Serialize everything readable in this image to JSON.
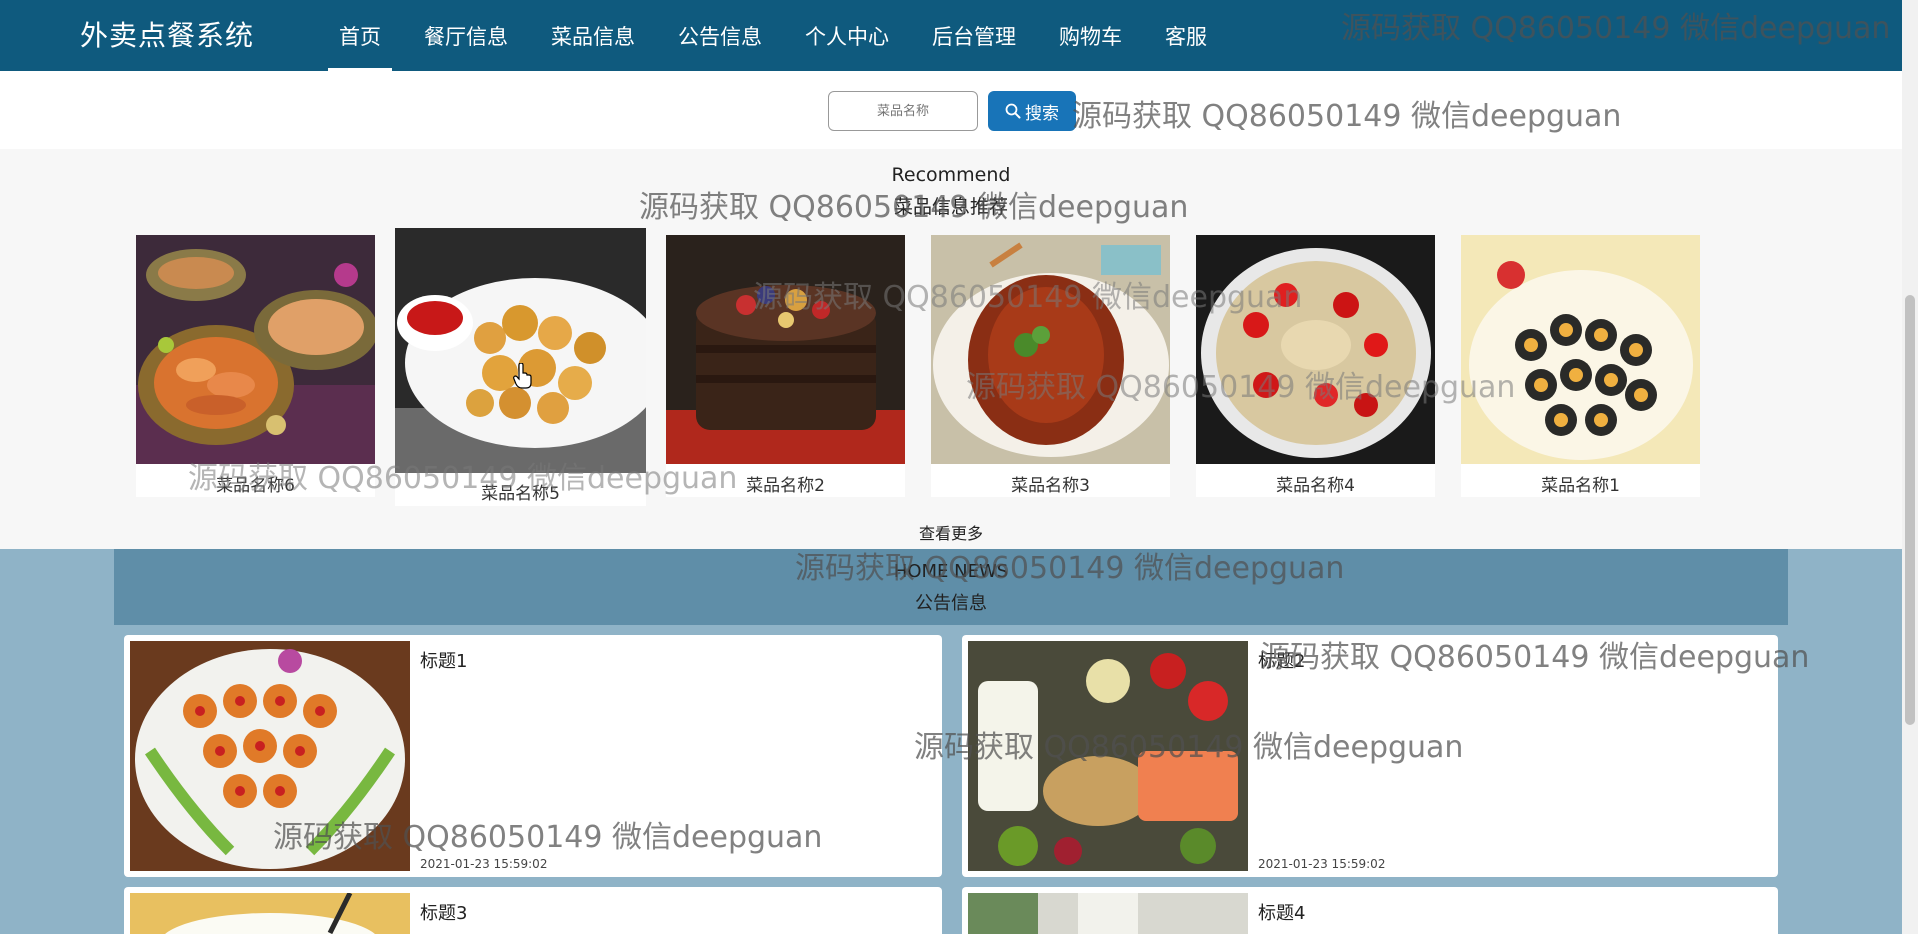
{
  "brand": {
    "title": "外卖点餐系统"
  },
  "nav": {
    "items": [
      {
        "label": "首页",
        "active": true
      },
      {
        "label": "餐厅信息"
      },
      {
        "label": "菜品信息"
      },
      {
        "label": "公告信息"
      },
      {
        "label": "个人中心"
      },
      {
        "label": "后台管理"
      },
      {
        "label": "购物车"
      },
      {
        "label": "客服"
      }
    ]
  },
  "search": {
    "placeholder": "菜品名称",
    "button_label": "搜索",
    "button_icon": "search-icon"
  },
  "recommend": {
    "title_en": "Recommend",
    "title_cn": "菜品信息推荐",
    "dishes": [
      {
        "name": "菜品名称6",
        "image": "seafood-platter"
      },
      {
        "name": "菜品名称5",
        "image": "fried-chicken"
      },
      {
        "name": "菜品名称2",
        "image": "chocolate-cake"
      },
      {
        "name": "菜品名称3",
        "image": "braised-fish"
      },
      {
        "name": "菜品名称4",
        "image": "spicy-chicken"
      },
      {
        "name": "菜品名称1",
        "image": "sushi-rolls"
      }
    ],
    "more_label": "查看更多"
  },
  "news": {
    "title_en": "HOME NEWS",
    "title_cn": "公告信息",
    "items": [
      {
        "title": "标题1",
        "date": "2021-01-23 15:59:02",
        "image": "carrot-tarts"
      },
      {
        "title": "标题2",
        "date": "2021-01-23 15:59:02",
        "image": "healthy-food"
      },
      {
        "title": "标题3",
        "image": "noodles"
      },
      {
        "title": "标题4",
        "image": "drink"
      }
    ]
  },
  "watermark": {
    "text": "源码获取 QQ86050149 微信deepguan"
  },
  "colors": {
    "nav_bg": "#0f5a7e",
    "search_button": "#1874b8",
    "news_bg": "#8fb3c7",
    "news_header": "#5f8ea8"
  }
}
